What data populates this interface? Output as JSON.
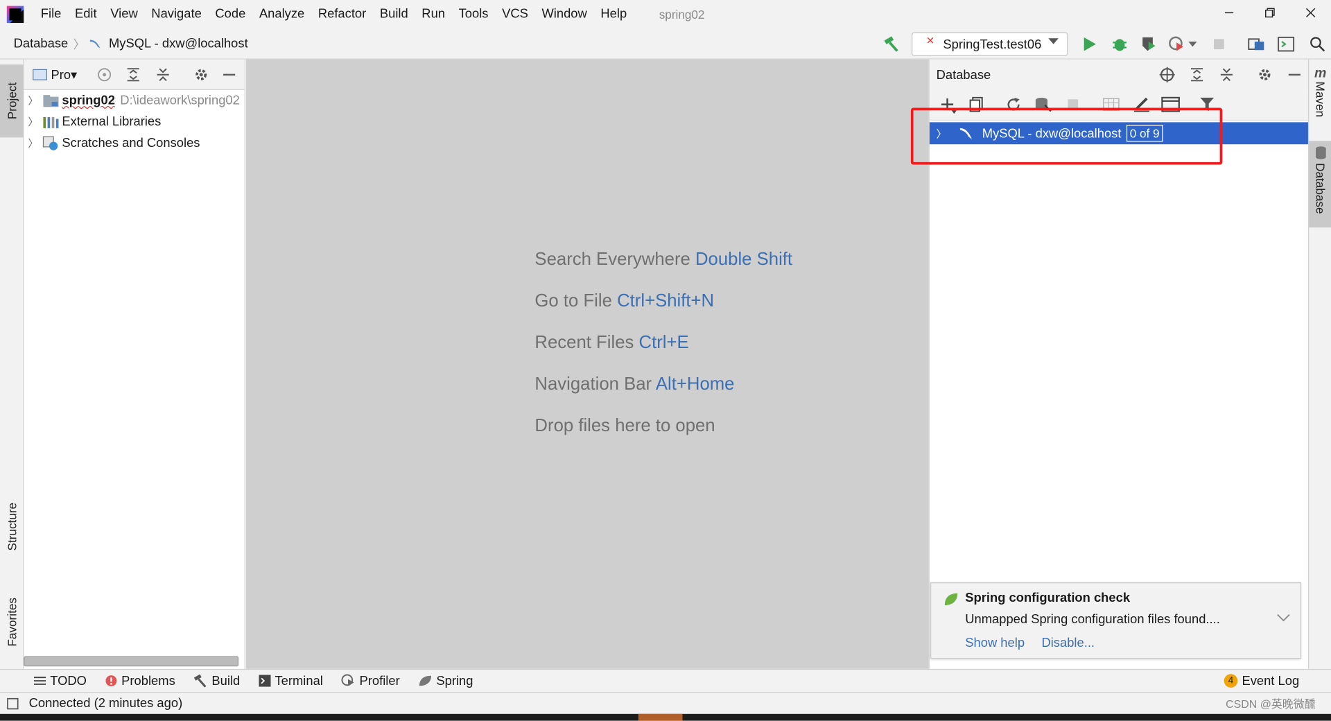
{
  "window": {
    "title": "spring02",
    "menu": [
      "File",
      "Edit",
      "View",
      "Navigate",
      "Code",
      "Analyze",
      "Refactor",
      "Build",
      "Run",
      "Tools",
      "VCS",
      "Window",
      "Help"
    ]
  },
  "navbar": {
    "breadcrumb_root": "Database",
    "breadcrumb_item": "MySQL - dxw@localhost",
    "run_config": "SpringTest.test06"
  },
  "left_stripe": {
    "project": "Project",
    "structure": "Structure",
    "favorites": "Favorites"
  },
  "project_panel": {
    "title": "Pro",
    "items": [
      {
        "label": "spring02",
        "path": "D:\\ideawork\\spring02"
      },
      {
        "label": "External Libraries"
      },
      {
        "label": "Scratches and Consoles"
      }
    ]
  },
  "editor_hints": [
    {
      "text": "Search Everywhere",
      "shortcut": "Double Shift"
    },
    {
      "text": "Go to File",
      "shortcut": "Ctrl+Shift+N"
    },
    {
      "text": "Recent Files",
      "shortcut": "Ctrl+E"
    },
    {
      "text": "Navigation Bar",
      "shortcut": "Alt+Home"
    },
    {
      "text": "Drop files here to open",
      "shortcut": ""
    }
  ],
  "database_panel": {
    "title": "Database",
    "connection": "MySQL - dxw@localhost",
    "schemas_badge": "0 of 9"
  },
  "right_stripe": {
    "maven": "Maven",
    "database": "Database"
  },
  "notification": {
    "title": "Spring configuration check",
    "body": "Unmapped Spring configuration files found....",
    "action1": "Show help",
    "action2": "Disable..."
  },
  "bottom_tools": {
    "todo": "TODO",
    "problems": "Problems",
    "build": "Build",
    "terminal": "Terminal",
    "profiler": "Profiler",
    "spring": "Spring",
    "event_log": "Event Log",
    "event_count": "4"
  },
  "status": {
    "text": "Connected (2 minutes ago)",
    "watermark": "CSDN @英晚微醺"
  },
  "colors": {
    "selection": "#2f65ca",
    "link": "#3b6fb3",
    "highlight_box": "#ee1c1c",
    "run_green": "#3aa655"
  }
}
